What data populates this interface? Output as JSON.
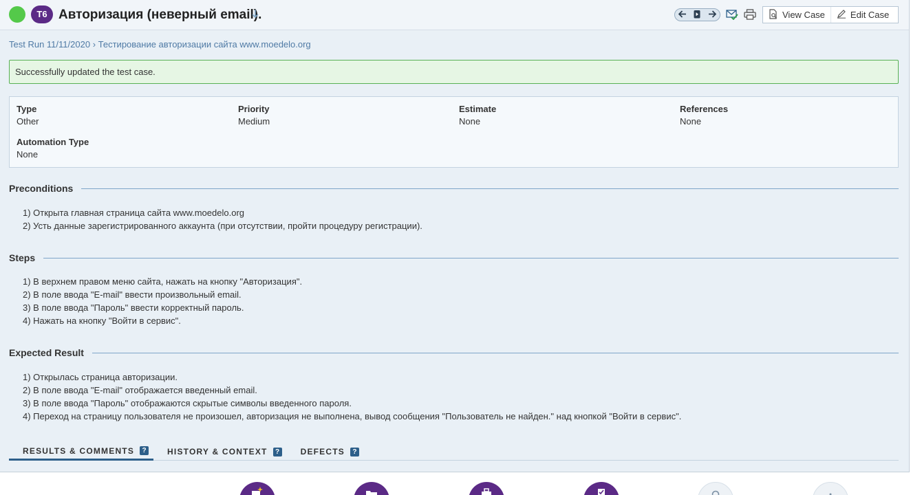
{
  "header": {
    "case_id": "T6",
    "title": "Авторизация (неверный email).",
    "status_color": "#54c94a",
    "title_arrow_icon": "arrow-down-icon",
    "view_case_label": "View Case",
    "edit_case_label": "Edit Case"
  },
  "breadcrumb": {
    "run": "Test Run 11/11/2020",
    "separator": "›",
    "suite": "Тестирование авторизации сайта www.moedelo.org"
  },
  "message": "Successfully updated the test case.",
  "fields": {
    "type": {
      "label": "Type",
      "value": "Other"
    },
    "priority": {
      "label": "Priority",
      "value": "Medium"
    },
    "estimate": {
      "label": "Estimate",
      "value": "None"
    },
    "references": {
      "label": "References",
      "value": "None"
    },
    "automation_type": {
      "label": "Automation Type",
      "value": "None"
    }
  },
  "preconditions": {
    "title": "Preconditions",
    "lines": [
      "1) Открыта главная страница сайта www.moedelo.org",
      "2) Усть данные зарегистрированного аккаунта (при отсутствии, пройти процедуру регистрации)."
    ]
  },
  "steps": {
    "title": "Steps",
    "lines": [
      "1) В верхнем правом меню сайта, нажать на кнопку \"Авторизация\".",
      "2) В поле ввода \"E-mail\" ввести произвольный email.",
      "3) В поле ввода \"Пароль\" ввести корректный пароль.",
      "4) Нажать на кнопку \"Войти в сервис\"."
    ]
  },
  "expected": {
    "title": "Expected Result",
    "lines": [
      "1) Открылась страница авторизации.",
      "2) В поле ввода \"E-mail\" отображается введенный email.",
      "3) В поле ввода \"Пароль\" отображаются скрытые символы введенного пароля.",
      "4) Переход на страницу пользователя не произошел, авторизация не выполнена, вывод сообщения \"Пользователь не найден.\" над кнопкой \"Войти в сервис\"."
    ]
  },
  "tabs": [
    {
      "label": "RESULTS & COMMENTS",
      "help": "?"
    },
    {
      "label": "HISTORY & CONTEXT",
      "help": "?"
    },
    {
      "label": "DEFECTS",
      "help": "?"
    }
  ],
  "colors": {
    "accent_purple": "#5b2a86",
    "link_blue": "#4f7aa5",
    "success_border": "#57b053"
  }
}
